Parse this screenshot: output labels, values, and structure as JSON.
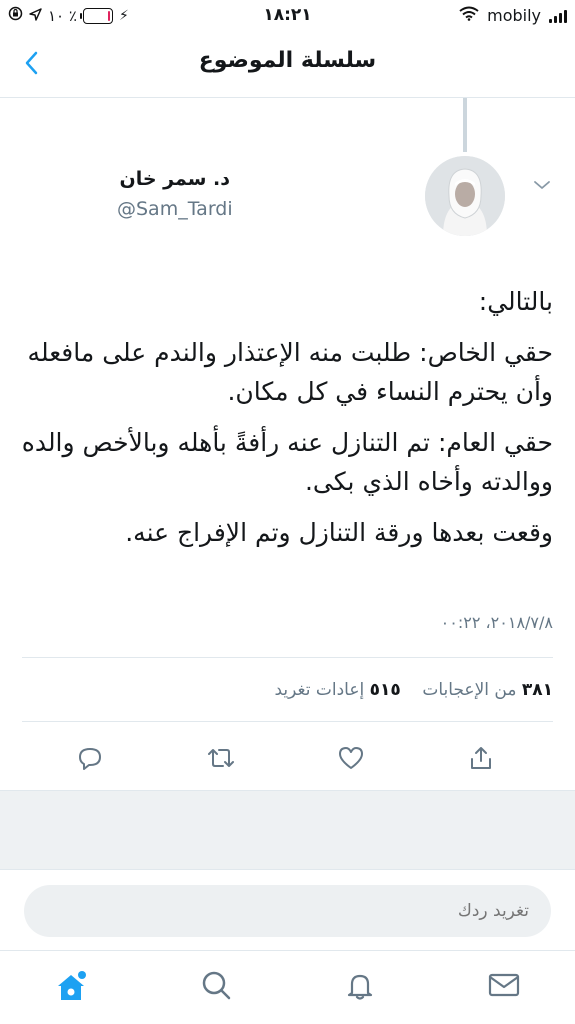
{
  "status_bar": {
    "battery_percent": "٪ ١٠",
    "battery_level": 0.1,
    "time": "١٨:٢١",
    "carrier": "mobily"
  },
  "nav": {
    "title": "سلسلة الموضوع",
    "back_icon": "chevron-left-icon"
  },
  "tweet": {
    "author_name": "د. سمر خان",
    "author_handle": "@Sam_Tardi",
    "lines": [
      "بالتالي:",
      "حقي الخاص: طلبت منه الإعتذار والندم على مافعله وأن يحترم النساء في كل مكان.",
      "حقي العام: تم التنازل عنه رأفةً بأهله وبالأخص والده ووالدته وأخاه الذي بكى.",
      "وقعت بعدها ورقة التنازل وتم الإفراج عنه."
    ],
    "timestamp": "٢٠١٨/٧/٨، ٠٠:٢٢",
    "likes_count": "٣٨١",
    "likes_label": "من الإعجابات",
    "retweets_count": "٥١٥",
    "retweets_label": "إعادات تغريد"
  },
  "reply": {
    "placeholder": "تغريد ردك"
  },
  "colors": {
    "accent": "#1da1f2",
    "text": "#14171a",
    "secondary": "#657786",
    "battery_low": "#e0245e"
  },
  "tab_bar": {
    "icons": [
      "home-icon",
      "search-icon",
      "notifications-icon",
      "messages-icon"
    ]
  }
}
